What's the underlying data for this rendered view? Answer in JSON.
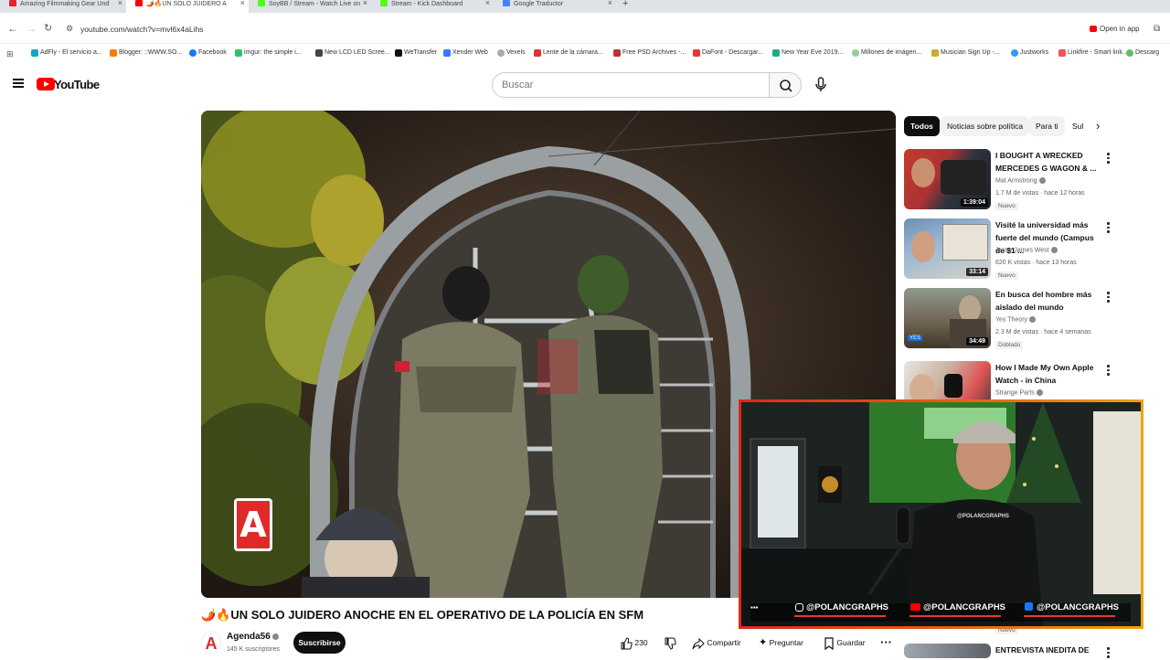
{
  "browser": {
    "tabs": [
      {
        "title": "Amazing Filmmaking Gear Und",
        "color": "#e4262a",
        "active": false
      },
      {
        "title": "🌶️🔥UN SOLO JUIDERO A",
        "color": "#ff0000",
        "active": true
      },
      {
        "title": "SoyBB / Stream - Watch Live on",
        "color": "#53fc18",
        "active": false
      },
      {
        "title": "Stream - Kick Dashboard",
        "color": "#53fc18",
        "active": false
      },
      {
        "title": "Google Traductor",
        "color": "#4285f4",
        "active": false
      }
    ],
    "url": "youtube.com/watch?v=mvl6x4aLihs",
    "open_in_app": "Open in app",
    "bookmarks": [
      "AdFly - El servicio a...",
      "Blogger: ::WWW.SO...",
      "Facebook",
      "imgur: the simple i...",
      "New LCD LED Scree...",
      "WeTransfer",
      "Xender Web",
      "Vexels",
      "Lente de la cámara...",
      "Free PSD Archives -...",
      "DaFont - Descargar...",
      "New Year Eve 2019...",
      "Millones de imágen...",
      "Musician Sign Up -...",
      "Justworks",
      "Linkfire - Smart link...",
      "Descarg"
    ]
  },
  "header": {
    "logo_text": "YouTube",
    "search_placeholder": "Buscar"
  },
  "video": {
    "title": "🌶️🔥UN SOLO JUIDERO ANOCHE EN EL OPERATIVO DE LA POLICÍA EN SFM",
    "watermark": "A",
    "channel": {
      "name": "Agenda56",
      "subscribers": "145 K suscriptores",
      "avatar_letter": "A"
    },
    "subscribe_label": "Suscribirse",
    "likes": "230",
    "share_label": "Compartir",
    "ask_label": "Preguntar",
    "save_label": "Guardar"
  },
  "sidebar": {
    "chips": [
      "Todos",
      "Noticias sobre política",
      "Para ti",
      "Sul"
    ],
    "recommendations": [
      {
        "title": "I BOUGHT A WRECKED MERCEDES G WAGON & ...",
        "channel": "Mat Armstrong",
        "meta": "1.7 M de vistas · hace 12 horas",
        "badge": "Nuevo",
        "duration": "1:39:04"
      },
      {
        "title": "Visité la universidad más fuerte del mundo (Campus de $1 ...",
        "channel": "Jesse James West",
        "meta": "620 K vistas · hace 13 horas",
        "badge": "Nuevo",
        "duration": "33:14"
      },
      {
        "title": "En busca del hombre más aislado del mundo",
        "channel": "Yes Theory",
        "meta": "2.3 M de vistas · hace 4 semanas",
        "badge": "Doblado",
        "duration": "34:49"
      },
      {
        "title": "How I Made My Own Apple Watch - in China",
        "channel": "Strange Parts",
        "meta": "",
        "badge": "",
        "duration": ""
      },
      {
        "title": "ENTREVISTA INEDITA DE",
        "channel": "",
        "meta": "",
        "badge": "Nuevo",
        "duration": ""
      }
    ]
  },
  "stream_overlay": {
    "socials": [
      "@POLANCGRAPHS",
      "@POLANCGRAPHS",
      "@POLANCGRAPHS"
    ],
    "shirt_text": "@POLANCGRAPHS"
  },
  "colors": {
    "yt_red": "#ff0000",
    "overlay_gradient_start": "#e0261b",
    "overlay_gradient_end": "#f0a10c"
  }
}
